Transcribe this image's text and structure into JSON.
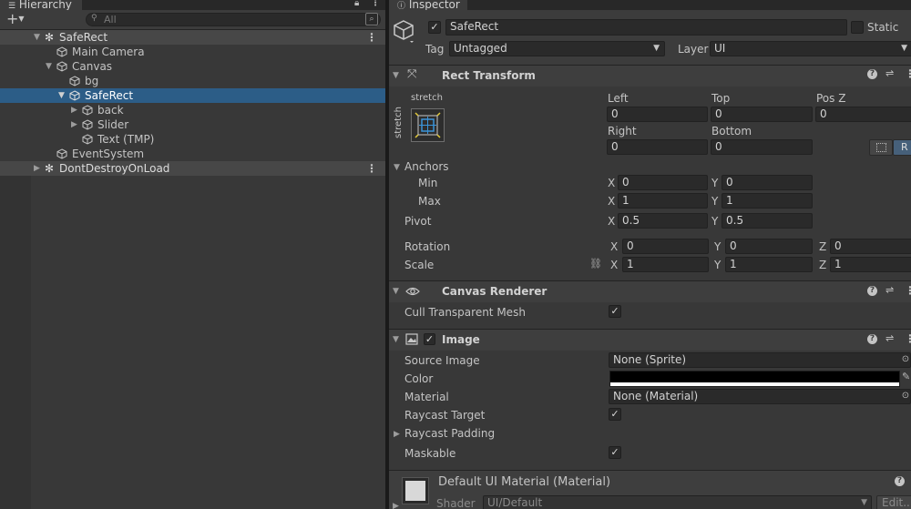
{
  "hierarchy": {
    "tab_label": "Hierarchy",
    "add_label": "+",
    "search_placeholder": "All",
    "items": [
      {
        "label": "SafeRect",
        "kind": "scene"
      },
      {
        "label": "Main Camera"
      },
      {
        "label": "Canvas"
      },
      {
        "label": "bg"
      },
      {
        "label": "SafeRect",
        "selected": true
      },
      {
        "label": "back"
      },
      {
        "label": "Slider"
      },
      {
        "label": "Text (TMP)"
      },
      {
        "label": "EventSystem"
      },
      {
        "label": "DontDestroyOnLoad",
        "kind": "scene"
      }
    ]
  },
  "inspector": {
    "tab_label": "Inspector",
    "object": {
      "name": "SafeRect",
      "static_label": "Static",
      "tag_label": "Tag",
      "tag_value": "Untagged",
      "layer_label": "Layer",
      "layer_value": "UI"
    },
    "rect_transform": {
      "title": "Rect Transform",
      "anchor_h": "stretch",
      "anchor_v": "stretch",
      "left_label": "Left",
      "left": "0",
      "top_label": "Top",
      "top": "0",
      "posz_label": "Pos Z",
      "posz": "0",
      "right_label": "Right",
      "right": "0",
      "bottom_label": "Bottom",
      "bottom": "0",
      "r_button": "R",
      "anchors_label": "Anchors",
      "min_label": "Min",
      "min_x": "0",
      "min_y": "0",
      "max_label": "Max",
      "max_x": "1",
      "max_y": "1",
      "pivot_label": "Pivot",
      "pivot_x": "0.5",
      "pivot_y": "0.5",
      "rotation_label": "Rotation",
      "rot_x": "0",
      "rot_y": "0",
      "rot_z": "0",
      "scale_label": "Scale",
      "scale_x": "1",
      "scale_y": "1",
      "scale_z": "1",
      "x": "X",
      "y": "Y",
      "z": "Z"
    },
    "canvas_renderer": {
      "title": "Canvas Renderer",
      "cull_label": "Cull Transparent Mesh",
      "cull_checked": true
    },
    "image": {
      "title": "Image",
      "source_image_label": "Source Image",
      "source_image_value": "None (Sprite)",
      "color_label": "Color",
      "color_value": "#000000",
      "material_label": "Material",
      "material_value": "None (Material)",
      "raycast_target_label": "Raycast Target",
      "raycast_padding_label": "Raycast Padding",
      "maskable_label": "Maskable"
    },
    "material_preview": {
      "title": "Default UI Material (Material)",
      "shader_label": "Shader",
      "shader_value": "UI/Default",
      "edit_label": "Edit..."
    }
  }
}
